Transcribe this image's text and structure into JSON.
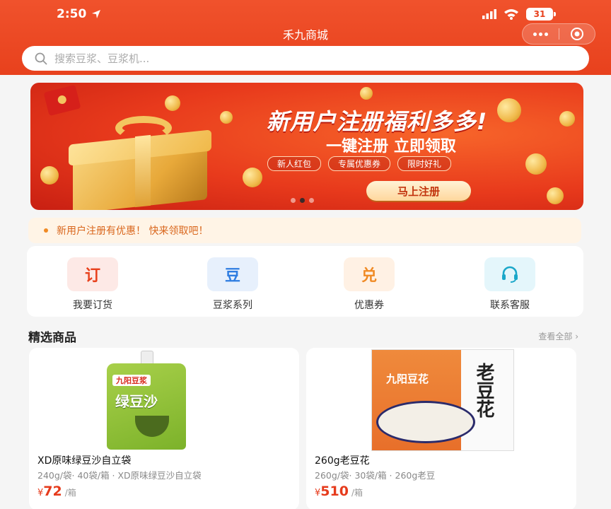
{
  "status_bar": {
    "time": "2:50",
    "battery": "31"
  },
  "header": {
    "title": "禾九商城"
  },
  "search": {
    "placeholder": "搜索豆浆、豆浆机..."
  },
  "banner": {
    "headline": "新用户注册福利多多!",
    "subline": "一键注册 立即领取",
    "tags": [
      "新人红包",
      "专属优惠券",
      "限时好礼"
    ],
    "cta": "马上注册",
    "slide_count": 3,
    "active_slide": 2
  },
  "notice": {
    "text": "新用户注册有优惠！ 快来领取吧！"
  },
  "quick_nav": [
    {
      "glyph": "订",
      "label": "我要订货",
      "color": "#e8411d",
      "bg": "#fde9e6"
    },
    {
      "glyph": "豆",
      "label": "豆浆系列",
      "color": "#2f7de1",
      "bg": "#e7f0fc"
    },
    {
      "glyph": "兑",
      "label": "优惠券",
      "color": "#f08a24",
      "bg": "#fff1e4"
    },
    {
      "glyph": "headset-icon",
      "label": "联系客服",
      "color": "#1aa7c9",
      "bg": "#e4f6fb"
    }
  ],
  "section": {
    "title": "精选商品",
    "more": "查看全部 ›"
  },
  "products": [
    {
      "name": "XD原味绿豆沙自立袋",
      "spec": "240g/袋· 40袋/箱 · XD原味绿豆沙自立袋",
      "currency": "¥",
      "price": "72",
      "unit": "/箱",
      "image_brand": "九阳豆浆",
      "image_title": "绿豆沙"
    },
    {
      "name": "260g老豆花",
      "spec": "260g/袋· 30袋/箱 · 260g老豆",
      "currency": "¥",
      "price": "510",
      "unit": "/箱",
      "image_brand": "九阳豆花",
      "image_title": "老豆花"
    }
  ]
}
